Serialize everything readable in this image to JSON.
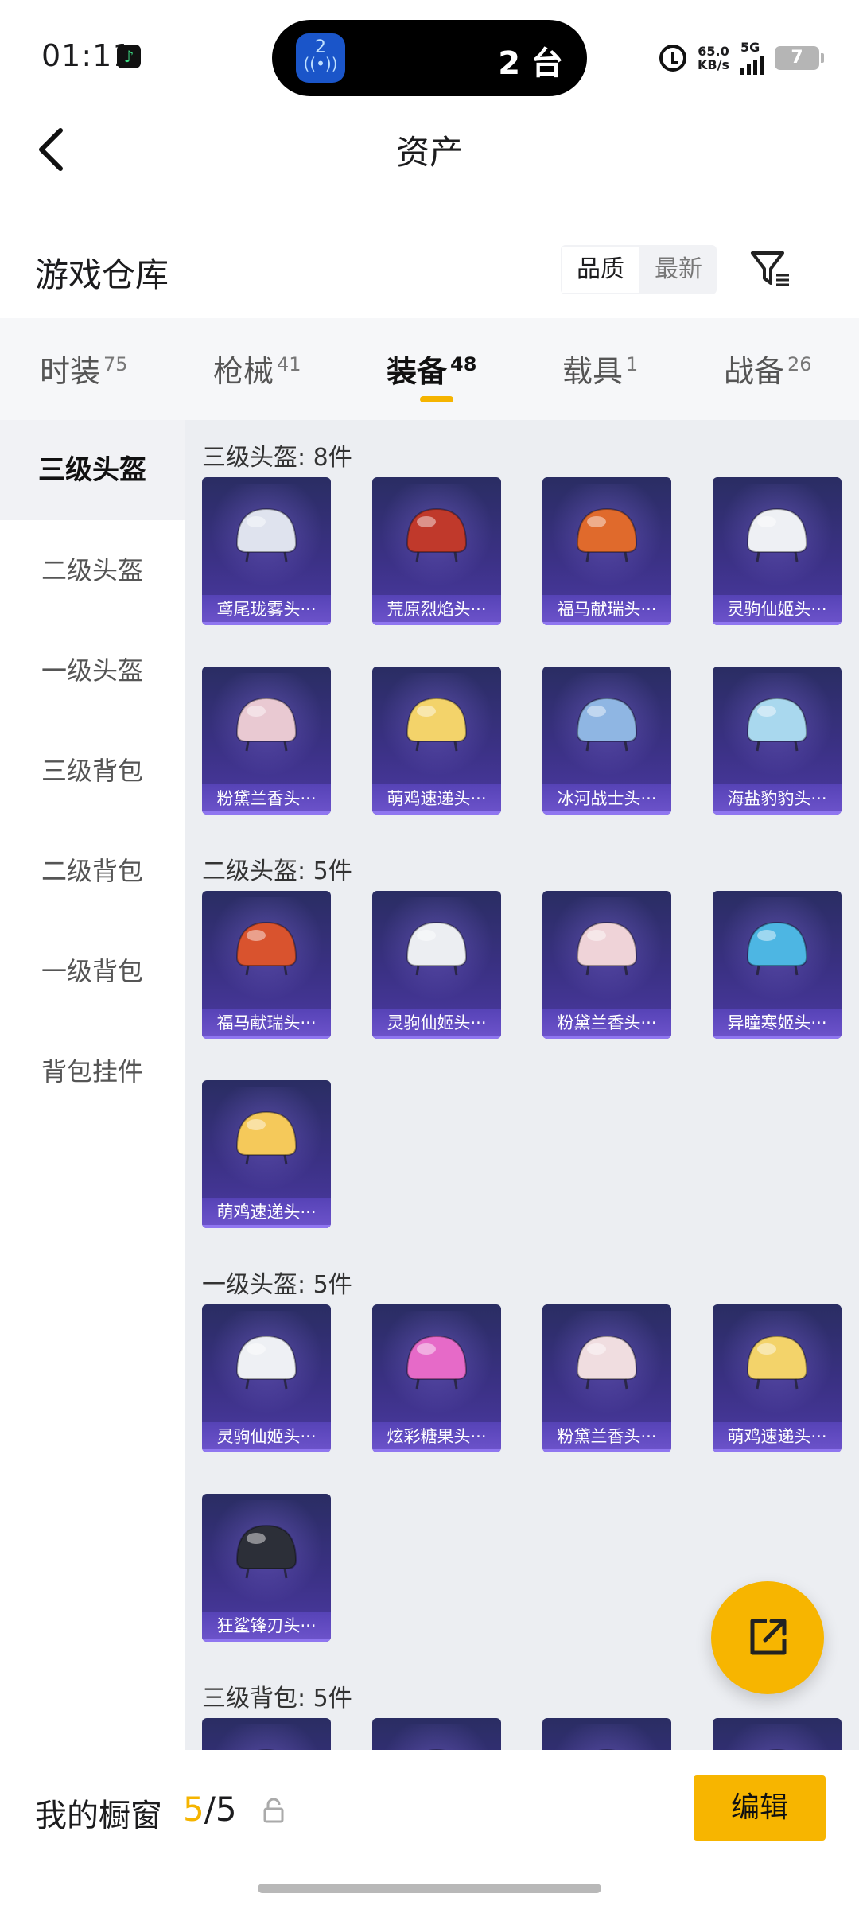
{
  "status_bar": {
    "time": "01:11",
    "island_text": "2 台",
    "island_badge": "2",
    "net_speed_value": "65.0",
    "net_speed_unit": "KB/s",
    "network": "5G",
    "battery": "7"
  },
  "header": {
    "title": "资产"
  },
  "warehouse": {
    "title": "游戏仓库",
    "sort_options": [
      "品质",
      "最新"
    ],
    "sort_selected": "品质"
  },
  "tabs": [
    {
      "label": "时装",
      "count": "75"
    },
    {
      "label": "枪械",
      "count": "41"
    },
    {
      "label": "装备",
      "count": "48",
      "active": true
    },
    {
      "label": "载具",
      "count": "1"
    },
    {
      "label": "战备",
      "count": "26"
    }
  ],
  "sidebar": {
    "items": [
      {
        "label": "三级头盔",
        "active": true
      },
      {
        "label": "二级头盔"
      },
      {
        "label": "一级头盔"
      },
      {
        "label": "三级背包"
      },
      {
        "label": "二级背包"
      },
      {
        "label": "一级背包"
      },
      {
        "label": "背包挂件"
      }
    ]
  },
  "sections": [
    {
      "title": "三级头盔: 8件",
      "items": [
        {
          "label": "鸢尾珑雾头···",
          "color": "#dfe3ee"
        },
        {
          "label": "荒原烈焰头···",
          "color": "#c0392b"
        },
        {
          "label": "福马献瑞头···",
          "color": "#e06a2c"
        },
        {
          "label": "灵驹仙姬头···",
          "color": "#eef0f4"
        },
        {
          "label": "粉黛兰香头···",
          "color": "#e9c9d2"
        },
        {
          "label": "萌鸡速递头···",
          "color": "#f3d36a"
        },
        {
          "label": "冰河战士头···",
          "color": "#8fb6e3"
        },
        {
          "label": "海盐豹豹头···",
          "color": "#a9d8ee"
        }
      ]
    },
    {
      "title": "二级头盔: 5件",
      "items": [
        {
          "label": "福马献瑞头···",
          "color": "#d9532e"
        },
        {
          "label": "灵驹仙姬头···",
          "color": "#eceef2"
        },
        {
          "label": "粉黛兰香头···",
          "color": "#efd3d8"
        },
        {
          "label": "异瞳寒姬头···",
          "color": "#4db6e3"
        },
        {
          "label": "萌鸡速递头···",
          "color": "#f5c95a"
        }
      ]
    },
    {
      "title": "一级头盔: 5件",
      "items": [
        {
          "label": "灵驹仙姬头···",
          "color": "#eef0f4"
        },
        {
          "label": "炫彩糖果头···",
          "color": "#e66ac8"
        },
        {
          "label": "粉黛兰香头···",
          "color": "#f0dde0"
        },
        {
          "label": "萌鸡速递头···",
          "color": "#f3d36a"
        },
        {
          "label": "狂鲨锋刃头···",
          "color": "#2c2f38"
        }
      ]
    },
    {
      "title": "三级背包: 5件",
      "items": [
        {
          "label": "",
          "color": "#e8eaf0"
        },
        {
          "label": "",
          "color": "#d9762f"
        },
        {
          "label": "",
          "color": "#e38cb5"
        },
        {
          "label": "",
          "color": "#e8b9c7"
        }
      ]
    }
  ],
  "bottom_bar": {
    "label": "我的橱窗",
    "current": "5",
    "separator": "/",
    "total": "5",
    "edit_label": "编辑"
  }
}
